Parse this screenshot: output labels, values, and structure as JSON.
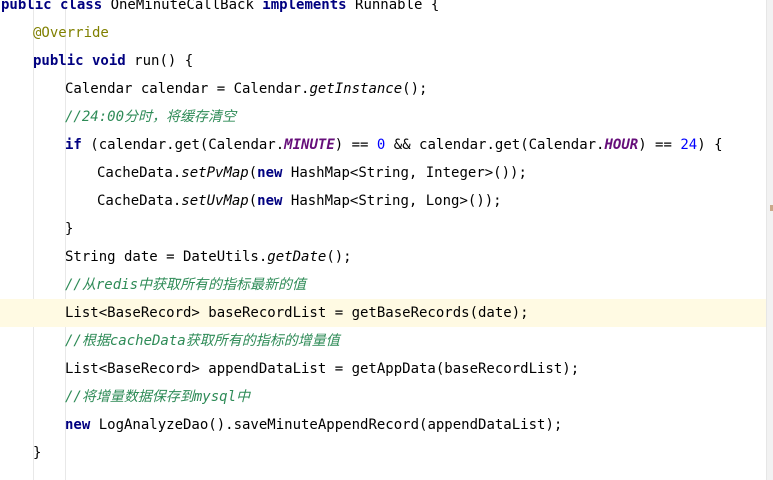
{
  "editor": {
    "highlight_color": "#fffae3",
    "lines": [
      {
        "indent": 0,
        "tokens": [
          {
            "t": "public class ",
            "s": "kw"
          },
          {
            "t": "OneMinuteCallBack ",
            "s": ""
          },
          {
            "t": "implements ",
            "s": "kw"
          },
          {
            "t": "Runnable {",
            "s": ""
          }
        ]
      },
      {
        "indent": 1,
        "tokens": [
          {
            "t": "@Override",
            "s": "ann"
          }
        ]
      },
      {
        "indent": 1,
        "tokens": [
          {
            "t": "public void ",
            "s": "kw"
          },
          {
            "t": "run() {",
            "s": ""
          }
        ]
      },
      {
        "indent": 2,
        "tokens": [
          {
            "t": "Calendar calendar = Calendar.",
            "s": ""
          },
          {
            "t": "getInstance",
            "s": "it"
          },
          {
            "t": "();",
            "s": ""
          }
        ]
      },
      {
        "indent": 2,
        "tokens": [
          {
            "t": "//24:00分时，将缓存清空",
            "s": "cm"
          }
        ]
      },
      {
        "indent": 2,
        "tokens": [
          {
            "t": "if ",
            "s": "kw"
          },
          {
            "t": "(calendar.get(Calendar.",
            "s": ""
          },
          {
            "t": "MINUTE",
            "s": "fld"
          },
          {
            "t": ") == ",
            "s": ""
          },
          {
            "t": "0 ",
            "s": "num"
          },
          {
            "t": "&& calendar.get(Calendar.",
            "s": ""
          },
          {
            "t": "HOUR",
            "s": "fld"
          },
          {
            "t": ") == ",
            "s": ""
          },
          {
            "t": "24",
            "s": "num"
          },
          {
            "t": ") {",
            "s": ""
          }
        ]
      },
      {
        "indent": 3,
        "tokens": [
          {
            "t": "CacheData.",
            "s": ""
          },
          {
            "t": "setPvMap",
            "s": "it"
          },
          {
            "t": "(",
            "s": ""
          },
          {
            "t": "new ",
            "s": "kw"
          },
          {
            "t": "HashMap<String, Integer>());",
            "s": ""
          }
        ]
      },
      {
        "indent": 3,
        "tokens": [
          {
            "t": "CacheData.",
            "s": ""
          },
          {
            "t": "setUvMap",
            "s": "it"
          },
          {
            "t": "(",
            "s": ""
          },
          {
            "t": "new ",
            "s": "kw"
          },
          {
            "t": "HashMap<String, Long>());",
            "s": ""
          }
        ]
      },
      {
        "indent": 2,
        "tokens": [
          {
            "t": "}",
            "s": ""
          }
        ]
      },
      {
        "indent": 2,
        "tokens": [
          {
            "t": "String date = DateUtils.",
            "s": ""
          },
          {
            "t": "getDate",
            "s": "it"
          },
          {
            "t": "();",
            "s": ""
          }
        ]
      },
      {
        "indent": 2,
        "tokens": [
          {
            "t": "//从redis中获取所有的指标最新的值",
            "s": "cm"
          }
        ]
      },
      {
        "indent": 2,
        "highlight": true,
        "tokens": [
          {
            "t": "List<BaseRecord> baseRecordList = getBaseRecords(date);",
            "s": ""
          }
        ]
      },
      {
        "indent": 2,
        "tokens": [
          {
            "t": "//根据cacheData获取所有的指标的增量值",
            "s": "cm"
          }
        ]
      },
      {
        "indent": 2,
        "tokens": [
          {
            "t": "List<BaseRecord> appendDataList = getAppData(baseRecordList);",
            "s": ""
          }
        ]
      },
      {
        "indent": 2,
        "tokens": [
          {
            "t": "//将增量数据保存到mysql中",
            "s": "cm"
          }
        ]
      },
      {
        "indent": 2,
        "tokens": [
          {
            "t": "new ",
            "s": "kw"
          },
          {
            "t": "LogAnalyzeDao().saveMinuteAppendRecord(appendDataList);",
            "s": ""
          }
        ]
      },
      {
        "indent": 1,
        "tokens": [
          {
            "t": "}",
            "s": ""
          }
        ]
      }
    ]
  }
}
